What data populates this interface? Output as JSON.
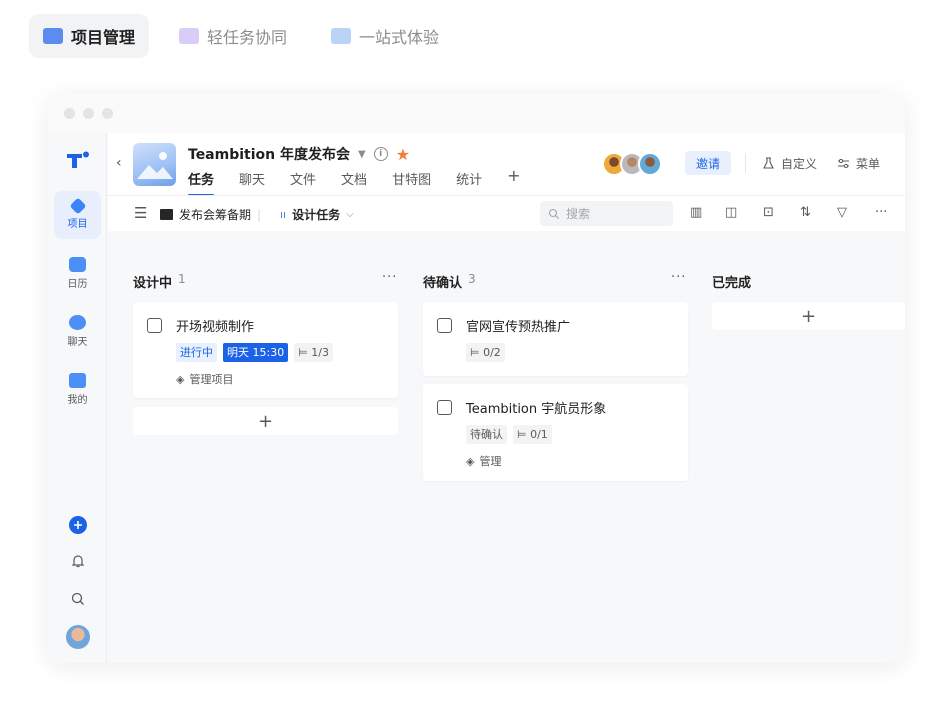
{
  "top_tabs": [
    {
      "label": "项目管理",
      "active": true,
      "icon": "folder-icon",
      "color": "#5b8def"
    },
    {
      "label": "轻任务协同",
      "active": false,
      "icon": "paperplane-icon",
      "color": "#c9b8f3"
    },
    {
      "label": "一站式体验",
      "active": false,
      "icon": "monitor-icon",
      "color": "#a8c9f5"
    }
  ],
  "rail": {
    "items": [
      {
        "label": "项目",
        "icon": "project-icon",
        "active": true
      },
      {
        "label": "日历",
        "icon": "calendar-icon",
        "active": false
      },
      {
        "label": "聊天",
        "icon": "chat-icon",
        "active": false
      },
      {
        "label": "我的",
        "icon": "me-icon",
        "active": false
      }
    ]
  },
  "header": {
    "project_title": "Teambition 年度发布会",
    "tabs": [
      "任务",
      "聊天",
      "文件",
      "文档",
      "甘特图",
      "统计"
    ],
    "active_tab": "任务",
    "invite_label": "邀请",
    "customize_label": "自定义",
    "menu_label": "菜单"
  },
  "toolbar": {
    "group_label": "发布会筹备期",
    "view_label": "设计任务",
    "search_placeholder": "搜索"
  },
  "board": {
    "columns": [
      {
        "title": "设计中",
        "count": "1"
      },
      {
        "title": "待确认",
        "count": "3"
      },
      {
        "title": "已完成",
        "count": ""
      }
    ],
    "cards": {
      "c1": {
        "title": "开场视频制作",
        "status": "进行中",
        "due": "明天 15:30",
        "subtasks": "1/3",
        "project": "管理项目"
      },
      "c2": {
        "title": "官网宣传预热推广",
        "subtasks": "0/2"
      },
      "c3": {
        "title": "Teambition 宇航员形象",
        "status": "待确认",
        "subtasks": "0/1",
        "project": "管理"
      }
    }
  },
  "colors": {
    "accent": "#1b62e6",
    "star": "#f07f3b"
  }
}
